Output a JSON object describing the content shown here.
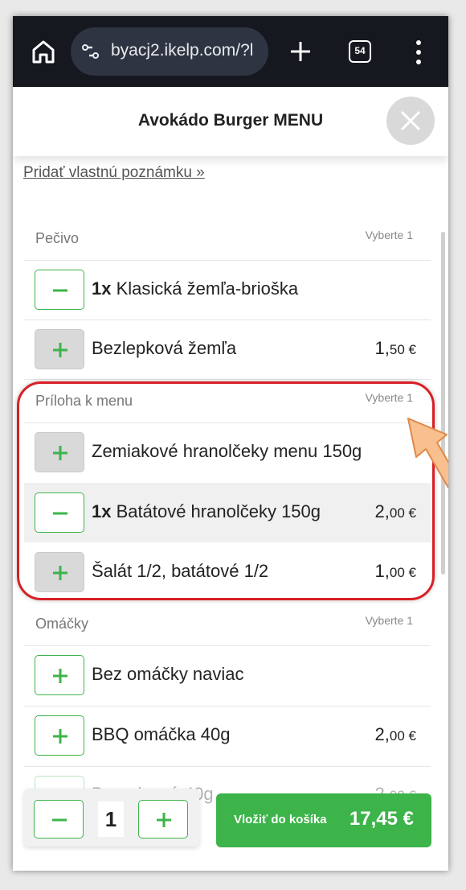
{
  "browser": {
    "url": "byacj2.ikelp.com/?l",
    "tab_count": "54"
  },
  "modal": {
    "title": "Avokádo Burger MENU",
    "note_link": "Pridať vlastnú poznámku »"
  },
  "sections": [
    {
      "name": "Pečivo",
      "requirement": "Vyberte 1",
      "items": [
        {
          "qty": "1x",
          "label": "Klasická žemľa-brioška",
          "price_main": "",
          "price_cents": "",
          "selected": true
        },
        {
          "qty": "",
          "label": "Bezlepková žemľa",
          "price_main": "1,",
          "price_cents": "50 €",
          "selected": false
        }
      ]
    },
    {
      "name": "Príloha k menu",
      "requirement": "Vyberte 1",
      "items": [
        {
          "qty": "",
          "label": "Zemiakové hranolčeky menu 150g",
          "price_main": "",
          "price_cents": "",
          "selected": false
        },
        {
          "qty": "1x",
          "label": "Batátové hranolčeky 150g",
          "price_main": "2,",
          "price_cents": "00 €",
          "selected": true
        },
        {
          "qty": "",
          "label": "Šalát 1/2, batátové 1/2",
          "price_main": "1,",
          "price_cents": "00 €",
          "selected": false
        }
      ]
    },
    {
      "name": "Omáčky",
      "requirement": "Vyberte 1",
      "items": [
        {
          "qty": "",
          "label": "Bez omáčky naviac",
          "price_main": "",
          "price_cents": "",
          "selected": false
        },
        {
          "qty": "",
          "label": "BBQ omáčka 40g",
          "price_main": "2,",
          "price_cents": "00 €",
          "selected": false
        },
        {
          "qty": "",
          "label": "Brusnicová 40g",
          "price_main": "2,",
          "price_cents": "00 €",
          "selected": false
        }
      ]
    }
  ],
  "footer": {
    "quantity": "1",
    "cart_label": "Vložiť do košíka",
    "cart_price": "17,45 €"
  },
  "colors": {
    "accent_green": "#3cb44a",
    "highlight_red": "#d81f26",
    "browser_bar": "#15181f"
  }
}
